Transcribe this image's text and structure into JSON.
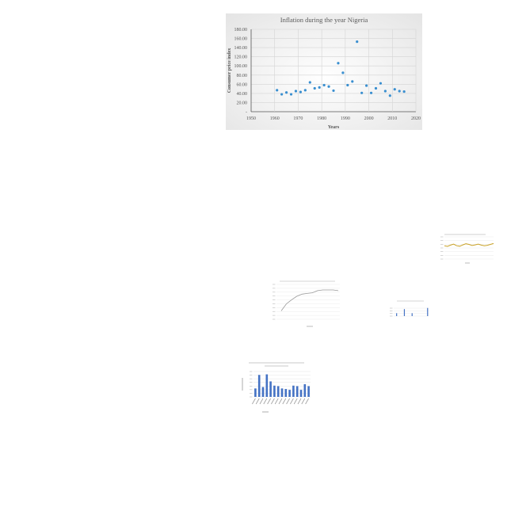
{
  "chart_data": [
    {
      "type": "scatter",
      "title": "Inflation during the year Nigeria",
      "xlabel": "Years",
      "ylabel": "Consumer price index",
      "xlim": [
        1950,
        2020
      ],
      "ylim": [
        0,
        180
      ],
      "x_ticks": [
        "1950",
        "1960",
        "1970",
        "1980",
        "1990",
        "2000",
        "2010",
        "2020"
      ],
      "y_ticks": [
        "-",
        "20.00",
        "40.00",
        "60.00",
        "80.00",
        "100.00",
        "120.00",
        "140.00",
        "160.00",
        "180.00"
      ],
      "grid": true,
      "marker_color": "#3a8fd0",
      "points": [
        {
          "x": 1961,
          "y": 47
        },
        {
          "x": 1963,
          "y": 38
        },
        {
          "x": 1965,
          "y": 42
        },
        {
          "x": 1967,
          "y": 38
        },
        {
          "x": 1969,
          "y": 45
        },
        {
          "x": 1971,
          "y": 43
        },
        {
          "x": 1973,
          "y": 47
        },
        {
          "x": 1975,
          "y": 64
        },
        {
          "x": 1977,
          "y": 51
        },
        {
          "x": 1979,
          "y": 53
        },
        {
          "x": 1981,
          "y": 58
        },
        {
          "x": 1983,
          "y": 55
        },
        {
          "x": 1985,
          "y": 46
        },
        {
          "x": 1987,
          "y": 106
        },
        {
          "x": 1989,
          "y": 85
        },
        {
          "x": 1991,
          "y": 58
        },
        {
          "x": 1993,
          "y": 66
        },
        {
          "x": 1995,
          "y": 153
        },
        {
          "x": 1997,
          "y": 41
        },
        {
          "x": 1999,
          "y": 57
        },
        {
          "x": 2001,
          "y": 41
        },
        {
          "x": 2003,
          "y": 51
        },
        {
          "x": 2005,
          "y": 62
        },
        {
          "x": 2007,
          "y": 45
        },
        {
          "x": 2009,
          "y": 35
        },
        {
          "x": 2011,
          "y": 49
        },
        {
          "x": 2013,
          "y": 45
        },
        {
          "x": 2015,
          "y": 44
        }
      ]
    },
    {
      "type": "line",
      "series_color": "#c9a227",
      "values": [
        60,
        57,
        63,
        67,
        60,
        58,
        64,
        69,
        66,
        61,
        64,
        67,
        63,
        60,
        62,
        66,
        70
      ]
    },
    {
      "type": "line",
      "series_color": "#999999",
      "values": [
        12,
        22,
        28,
        33,
        36,
        37,
        38,
        41,
        42,
        42,
        42,
        41
      ]
    },
    {
      "type": "bar",
      "series_color": "#4472c4",
      "values": [
        0,
        10,
        0,
        0,
        0,
        24,
        0,
        0,
        0,
        10,
        0,
        0,
        0,
        0,
        0,
        0,
        0,
        28
      ]
    },
    {
      "type": "bar",
      "series_color": "#4472c4",
      "values": [
        30,
        78,
        35,
        80,
        55,
        40,
        38,
        30,
        28,
        25,
        40,
        38,
        25,
        45,
        38
      ]
    }
  ]
}
